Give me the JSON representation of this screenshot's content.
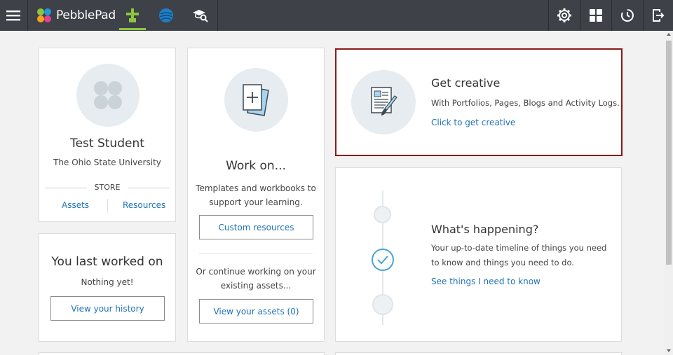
{
  "app": {
    "brand": "PebblePad",
    "accent": "#8cc63f",
    "topbar_color": "#3e4147"
  },
  "topbar": {
    "left_icons": [
      "menu-icon",
      "pebblepad-logo",
      "home-plus-icon",
      "globe-icon",
      "graduation-search-icon"
    ],
    "right_icons": [
      "gear-icon",
      "grid-icon",
      "history-icon",
      "logout-icon"
    ]
  },
  "profile": {
    "name": "Test Student",
    "institution": "The Ohio State University",
    "store_label": "STORE",
    "assets_link": "Assets",
    "resources_link": "Resources"
  },
  "history": {
    "title": "You last worked on",
    "subtitle": "Nothing yet!",
    "button": "View your history"
  },
  "workon": {
    "title": "Work on...",
    "desc_line1": "Templates and workbooks to",
    "desc_line2": "support your learning.",
    "custom_button": "Custom resources",
    "cont_line1": "Or continue working on your",
    "cont_line2": "existing assets...",
    "assets_button": "View your assets (0)"
  },
  "creative": {
    "title": "Get creative",
    "desc": "With Portfolios, Pages, Blogs and Activity Logs.",
    "link": "Click to get creative",
    "border_color": "#8b1a1a"
  },
  "happening": {
    "title": "What's happening?",
    "desc": "Your up-to-date timeline of things you need to know and things you need to do.",
    "link": "See things I need to know"
  }
}
